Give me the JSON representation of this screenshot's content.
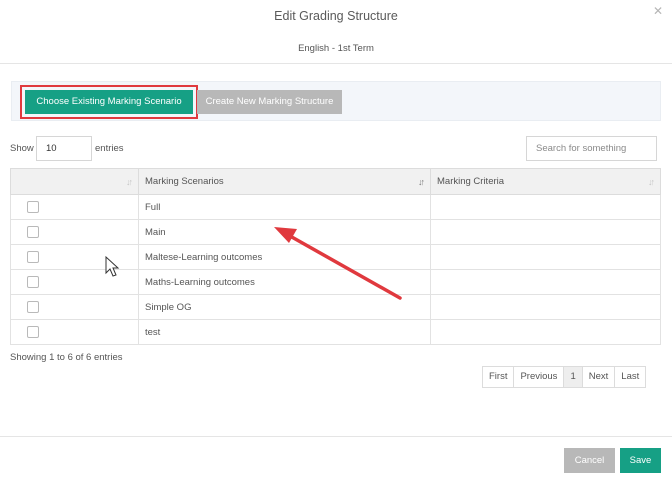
{
  "dialog": {
    "title": "Edit Grading Structure",
    "subtitle": "English - 1st Term",
    "close_glyph": "✕"
  },
  "tabs": {
    "choose_existing": "Choose Existing Marking Scenario",
    "create_new": "Create New Marking Structure"
  },
  "table_controls": {
    "show_label": "Show",
    "entries_value": "10",
    "entries_label": "entries",
    "search_placeholder": "Search for something"
  },
  "table": {
    "headers": [
      "",
      "Marking Scenarios",
      "Marking Criteria"
    ],
    "rows": [
      {
        "scenario": "Full",
        "criteria": ""
      },
      {
        "scenario": "Main",
        "criteria": ""
      },
      {
        "scenario": "Maltese-Learning outcomes",
        "criteria": ""
      },
      {
        "scenario": "Maths-Learning outcomes",
        "criteria": ""
      },
      {
        "scenario": "Simple OG",
        "criteria": ""
      },
      {
        "scenario": "test",
        "criteria": ""
      }
    ]
  },
  "info": "Showing 1 to 6 of 6 entries",
  "pagination": {
    "first": "First",
    "previous": "Previous",
    "current": "1",
    "next": "Next",
    "last": "Last"
  },
  "footer": {
    "cancel": "Cancel",
    "save": "Save"
  },
  "icons": {
    "sort": "sort-icon",
    "sort_active": "sort-asc-icon",
    "close": "close-icon",
    "cursor": "mouse-pointer-icon",
    "annotation": "red-arrow-annotation"
  },
  "colors": {
    "accent": "#16a085",
    "disabled": "#b8b8b8",
    "highlight": "#e0393e"
  }
}
